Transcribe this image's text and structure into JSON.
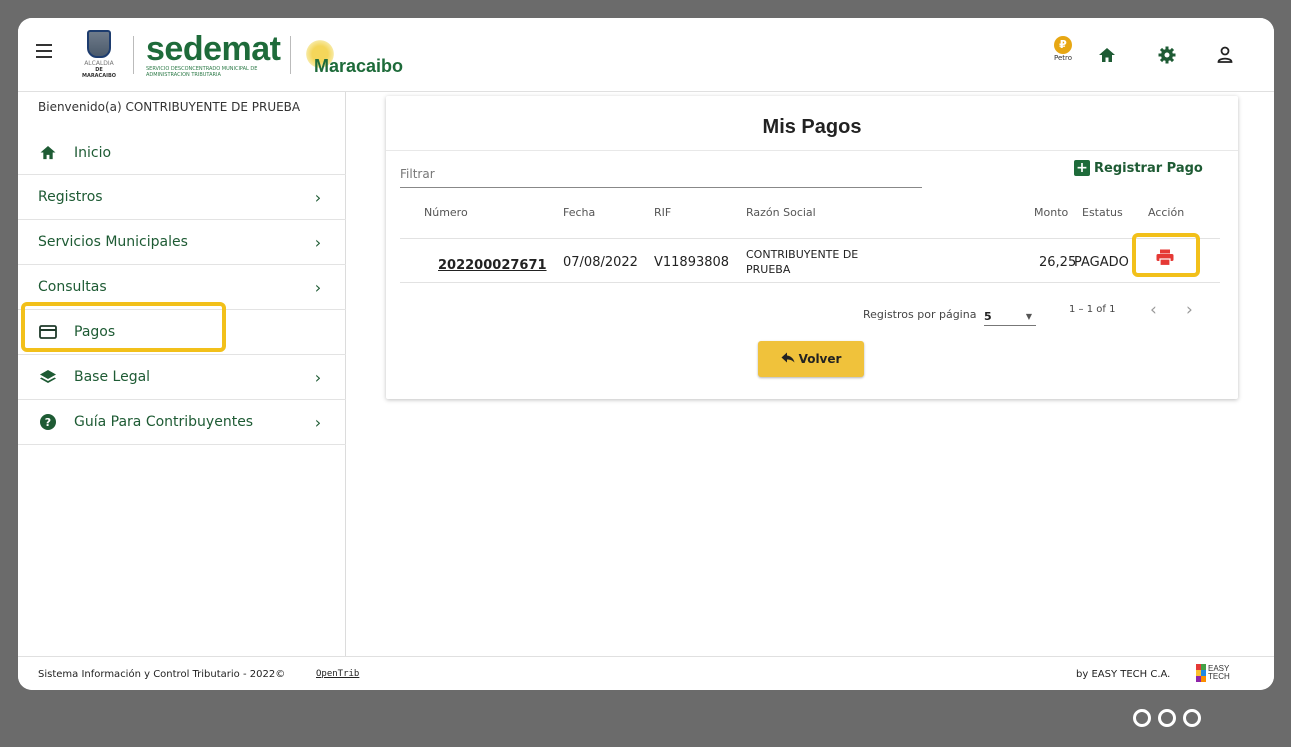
{
  "header": {
    "crest_caption1": "ALCALDIA",
    "crest_caption2": "DE MARACAIBO",
    "brand_name": "sedemat",
    "brand_sub": "SERVICIO DESCONCENTRADO MUNICIPAL DE ADMINISTRACION TRIBUTARIA",
    "city": "Maracaibo",
    "petro_symbol": "₽",
    "petro_label": "Petro",
    "icons": [
      "menu-icon",
      "petro-icon",
      "home-icon",
      "settings-icon",
      "user-icon"
    ]
  },
  "sidebar": {
    "welcome": "Bienvenido(a) CONTRIBUYENTE DE PRUEBA",
    "items": [
      {
        "label": "Inicio",
        "icon": "home-icon"
      },
      {
        "label": "Registros"
      },
      {
        "label": "Servicios Municipales"
      },
      {
        "label": "Consultas"
      },
      {
        "label": "Pagos",
        "icon": "card-icon"
      },
      {
        "label": "Base Legal",
        "icon": "layers-icon"
      },
      {
        "label": "Guía Para Contribuyentes",
        "icon": "help-icon"
      }
    ]
  },
  "main": {
    "title": "Mis Pagos",
    "filter_placeholder": "Filtrar",
    "register_label": "Registrar Pago",
    "columns": [
      "Número",
      "Fecha",
      "RIF",
      "Razón Social",
      "Monto",
      "Estatus",
      "Acción"
    ],
    "rows": [
      {
        "numero": "202200027671",
        "fecha": "07/08/2022",
        "rif": "V11893808",
        "razon_social_1": "CONTRIBUYENTE DE",
        "razon_social_2": "PRUEBA",
        "monto": "26,25",
        "estatus": "PAGADO"
      }
    ],
    "pager": {
      "per_page_label": "Registros por página",
      "per_page_value": "5",
      "range": "1 – 1 of 1"
    },
    "volver_label": "Volver"
  },
  "footer": {
    "left_text": "Sistema Información y Control Tributario -  2022©",
    "opentrib": "OpenTrib",
    "right_text": "by EASY TECH C.A.",
    "logo_text_1": "EASY",
    "logo_text_2": "TECH"
  },
  "colors": {
    "accent_green": "#1e6b3a",
    "highlight_yellow": "#f2c01a",
    "button_yellow": "#f0c23b",
    "print_red": "#e53935"
  }
}
